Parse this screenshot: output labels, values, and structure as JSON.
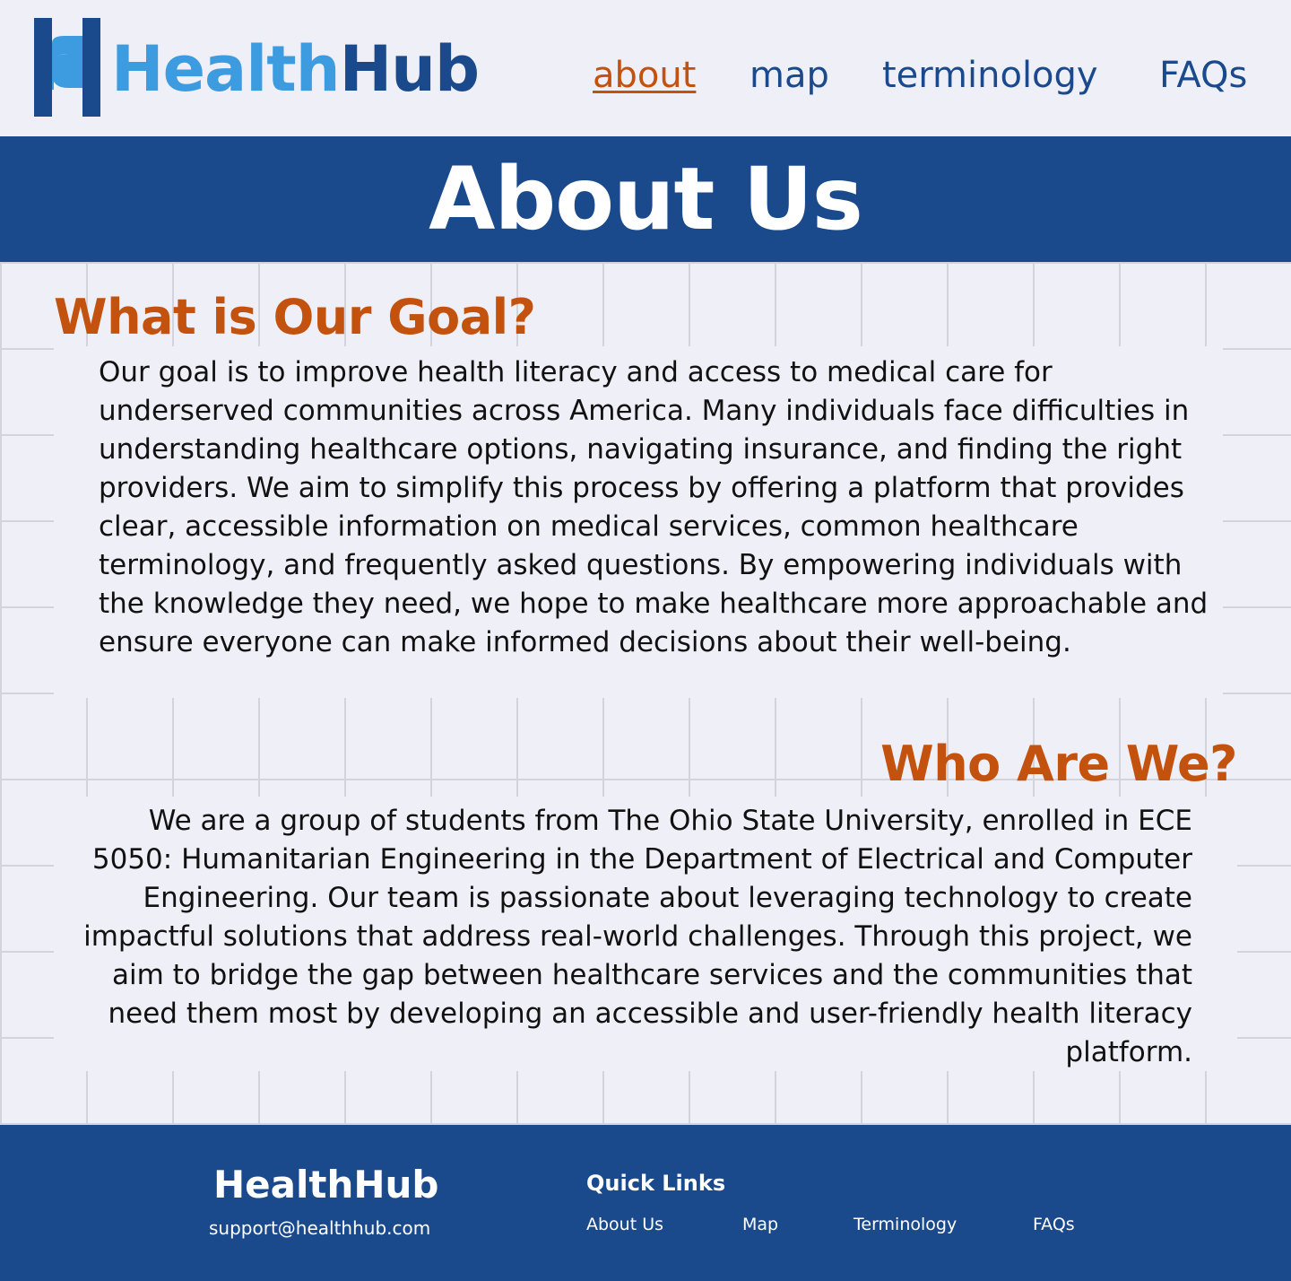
{
  "header": {
    "logo": {
      "part1": "Health",
      "part2": "Hub",
      "mark_icon": "h-logo-icon",
      "colors": {
        "light": "#3d9be0",
        "dark": "#1b4a8c"
      }
    },
    "nav": [
      {
        "label": "about",
        "active": true
      },
      {
        "label": "map",
        "active": false
      },
      {
        "label": "terminology",
        "active": false
      },
      {
        "label": "FAQs",
        "active": false
      }
    ]
  },
  "banner": {
    "title": "About Us"
  },
  "sections": {
    "goal": {
      "heading": "What is Our Goal?",
      "body": "Our goal is to improve health literacy and access to medical care for underserved communities across America. Many individuals face difficulties in understanding healthcare options, navigating insurance, and finding the right providers. We aim to simplify this process by offering a platform that provides clear, accessible information on medical services, common healthcare terminology, and frequently asked questions. By empowering individuals with the knowledge they need, we hope to make healthcare more approachable and ensure everyone can make informed decisions about their well-being."
    },
    "who": {
      "heading": "Who Are We?",
      "body": "We are a group of students from The Ohio State University, enrolled in ECE 5050: Humanitarian Engineering in the Department of Electrical and Computer Engineering. Our team is passionate about leveraging technology to create impactful solutions that address real-world challenges. Through this project, we aim to bridge the gap between healthcare services and the communities that need them most by developing an accessible and user-friendly health literacy platform."
    }
  },
  "footer": {
    "brand": "HealthHub",
    "email": "support@healthhub.com",
    "quick_links_title": "Quick Links",
    "links": [
      "About Us",
      "Map",
      "Terminology",
      "FAQs"
    ]
  },
  "colors": {
    "primary": "#1b4a8c",
    "accent": "#c4520f",
    "light_blue": "#3d9be0",
    "background": "#eff0f7"
  }
}
